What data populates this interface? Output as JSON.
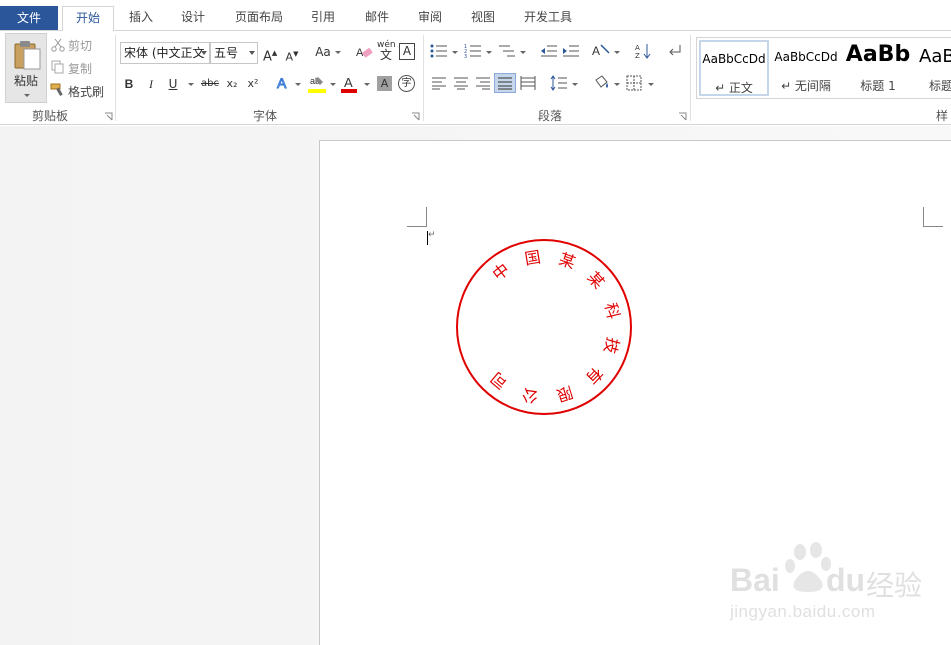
{
  "tabs": {
    "file": "文件",
    "home": "开始",
    "insert": "插入",
    "design": "设计",
    "layout": "页面布局",
    "references": "引用",
    "mailings": "邮件",
    "review": "审阅",
    "view": "视图",
    "developer": "开发工具"
  },
  "clipboard": {
    "paste": "粘贴",
    "cut": "剪切",
    "copy": "复制",
    "format_painter": "格式刷",
    "group_label": "剪贴板"
  },
  "font": {
    "font_name": "宋体 (中文正文",
    "font_size": "五号",
    "bold": "B",
    "italic": "I",
    "underline": "U",
    "strikethrough": "abc",
    "subscript": "x₂",
    "superscript": "x²",
    "change_case": "Aa",
    "phonetic_top": "wén",
    "phonetic_bottom": "文",
    "char_border": "A",
    "enclose_char": "字",
    "group_label": "字体"
  },
  "paragraph": {
    "group_label": "段落"
  },
  "styles": {
    "items": [
      {
        "preview": "AaBbCcDd",
        "name": "↵ 正文"
      },
      {
        "preview": "AaBbCcDd",
        "name": "↵ 无间隔"
      },
      {
        "preview": "AaBb",
        "name": "标题 1"
      },
      {
        "preview": "AaB",
        "name": "标题"
      }
    ],
    "group_label": "样"
  },
  "document": {
    "paragraph_mark": "↵",
    "seal": {
      "text": "中国某某科技有限公司",
      "color": "#e00000"
    }
  },
  "watermark": {
    "brand_a": "Bai",
    "brand_b": "du",
    "brand_cn": "经验",
    "url": "jingyan.baidu.com"
  },
  "colors": {
    "file_tab": "#2b579a",
    "accent": "#2b579a",
    "highlight_yellow": "#ffff00",
    "font_red": "#e00000"
  }
}
